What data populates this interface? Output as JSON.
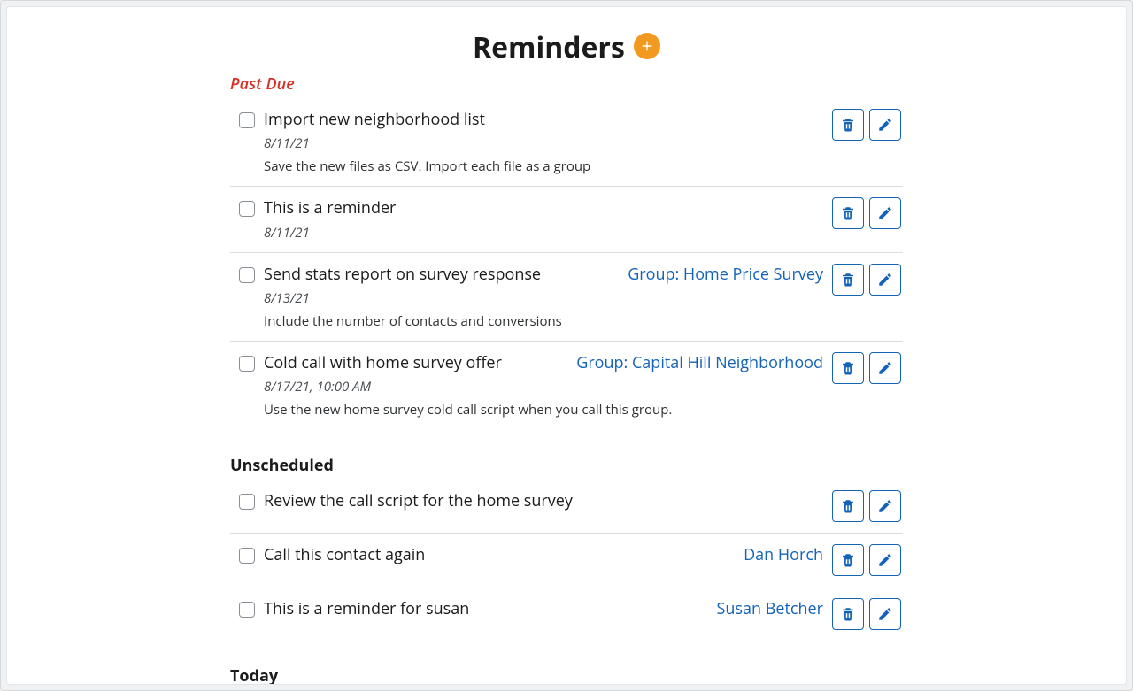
{
  "header": {
    "title": "Reminders"
  },
  "sections": {
    "past_due": {
      "label": "Past Due",
      "items": [
        {
          "title": "Import new neighborhood list",
          "date": "8/11/21",
          "note": "Save the new files as CSV. Import each file as a group",
          "link": ""
        },
        {
          "title": "This is a reminder",
          "date": "8/11/21",
          "note": "",
          "link": ""
        },
        {
          "title": "Send stats report on survey response",
          "date": "8/13/21",
          "note": "Include the number of contacts and conversions",
          "link": "Group: Home Price Survey"
        },
        {
          "title": "Cold call with home survey offer",
          "date": "8/17/21, 10:00 AM",
          "note": "Use the new home survey cold call script when you call this group.",
          "link": "Group: Capital Hill Neighborhood"
        }
      ]
    },
    "unscheduled": {
      "label": "Unscheduled",
      "items": [
        {
          "title": "Review the call script for the home survey",
          "date": "",
          "note": "",
          "link": ""
        },
        {
          "title": "Call this contact again",
          "date": "",
          "note": "",
          "link": "Dan Horch"
        },
        {
          "title": "This is a reminder for susan",
          "date": "",
          "note": "",
          "link": "Susan Betcher"
        }
      ]
    },
    "today": {
      "label": "Today",
      "items": []
    }
  }
}
